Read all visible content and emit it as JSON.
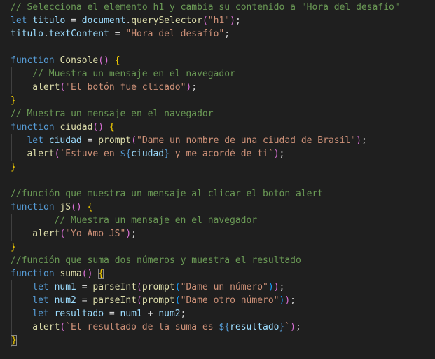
{
  "editor": {
    "language": "javascript",
    "lines": [
      {
        "indent": 0,
        "tokens": [
          {
            "t": "com",
            "v": "// Selecciona el elemento h1 y cambia su contenido a \"Hora del desafío\""
          }
        ]
      },
      {
        "indent": 0,
        "tokens": [
          {
            "t": "kw",
            "v": "let"
          },
          {
            "t": "op",
            "v": " "
          },
          {
            "t": "var",
            "v": "titulo"
          },
          {
            "t": "op",
            "v": " = "
          },
          {
            "t": "var",
            "v": "document"
          },
          {
            "t": "op",
            "v": "."
          },
          {
            "t": "fn",
            "v": "querySelector"
          },
          {
            "t": "br2",
            "v": "("
          },
          {
            "t": "str",
            "v": "\"h1\""
          },
          {
            "t": "br2",
            "v": ")"
          },
          {
            "t": "op",
            "v": ";"
          }
        ]
      },
      {
        "indent": 0,
        "tokens": [
          {
            "t": "var",
            "v": "titulo"
          },
          {
            "t": "op",
            "v": "."
          },
          {
            "t": "var",
            "v": "textContent"
          },
          {
            "t": "op",
            "v": " = "
          },
          {
            "t": "str",
            "v": "\"Hora del desafío\""
          },
          {
            "t": "op",
            "v": ";"
          }
        ]
      },
      {
        "indent": 0,
        "tokens": []
      },
      {
        "indent": 0,
        "tokens": [
          {
            "t": "kw",
            "v": "function"
          },
          {
            "t": "op",
            "v": " "
          },
          {
            "t": "fn",
            "v": "Console"
          },
          {
            "t": "br2",
            "v": "()"
          },
          {
            "t": "op",
            "v": " "
          },
          {
            "t": "br",
            "v": "{"
          }
        ]
      },
      {
        "indent": 4,
        "tokens": [
          {
            "t": "com",
            "v": "// Muestra un mensaje en el navegador"
          }
        ]
      },
      {
        "indent": 4,
        "tokens": [
          {
            "t": "fn",
            "v": "alert"
          },
          {
            "t": "br2",
            "v": "("
          },
          {
            "t": "str",
            "v": "\"El botón fue clicado\""
          },
          {
            "t": "br2",
            "v": ")"
          },
          {
            "t": "op",
            "v": ";"
          }
        ]
      },
      {
        "indent": 0,
        "tokens": [
          {
            "t": "br",
            "v": "}"
          }
        ]
      },
      {
        "indent": 0,
        "tokens": [
          {
            "t": "com",
            "v": "// Muestra un mensaje en el navegador"
          }
        ]
      },
      {
        "indent": 0,
        "tokens": [
          {
            "t": "kw",
            "v": "function"
          },
          {
            "t": "op",
            "v": " "
          },
          {
            "t": "fn",
            "v": "ciudad"
          },
          {
            "t": "br2",
            "v": "()"
          },
          {
            "t": "op",
            "v": " "
          },
          {
            "t": "br",
            "v": "{"
          }
        ]
      },
      {
        "indent": 3,
        "tokens": [
          {
            "t": "kw",
            "v": "let"
          },
          {
            "t": "op",
            "v": " "
          },
          {
            "t": "var",
            "v": "ciudad"
          },
          {
            "t": "op",
            "v": " = "
          },
          {
            "t": "fn",
            "v": "prompt"
          },
          {
            "t": "br2",
            "v": "("
          },
          {
            "t": "str",
            "v": "\"Dame un nombre de una ciudad de Brasil\""
          },
          {
            "t": "br2",
            "v": ")"
          },
          {
            "t": "op",
            "v": ";"
          }
        ]
      },
      {
        "indent": 3,
        "tokens": [
          {
            "t": "fn",
            "v": "alert"
          },
          {
            "t": "br2",
            "v": "("
          },
          {
            "t": "str",
            "v": "`Estuve en "
          },
          {
            "t": "kw",
            "v": "${"
          },
          {
            "t": "var",
            "v": "ciudad"
          },
          {
            "t": "kw",
            "v": "}"
          },
          {
            "t": "str",
            "v": " y me acordé de ti`"
          },
          {
            "t": "br2",
            "v": ")"
          },
          {
            "t": "op",
            "v": ";"
          }
        ]
      },
      {
        "indent": 0,
        "tokens": [
          {
            "t": "br",
            "v": "}"
          }
        ]
      },
      {
        "indent": 0,
        "tokens": []
      },
      {
        "indent": 0,
        "tokens": [
          {
            "t": "com",
            "v": "//función que muestra un mensaje al clicar el botón alert"
          }
        ]
      },
      {
        "indent": 0,
        "tokens": [
          {
            "t": "kw",
            "v": "function"
          },
          {
            "t": "op",
            "v": " "
          },
          {
            "t": "fn",
            "v": "jS"
          },
          {
            "t": "br2",
            "v": "()"
          },
          {
            "t": "op",
            "v": " "
          },
          {
            "t": "br",
            "v": "{"
          }
        ]
      },
      {
        "indent": 8,
        "tokens": [
          {
            "t": "com",
            "v": "// Muestra un mensaje en el navegador"
          }
        ]
      },
      {
        "indent": 4,
        "tokens": [
          {
            "t": "fn",
            "v": "alert"
          },
          {
            "t": "br2",
            "v": "("
          },
          {
            "t": "str",
            "v": "\"Yo Amo JS\""
          },
          {
            "t": "br2",
            "v": ")"
          },
          {
            "t": "op",
            "v": ";"
          }
        ]
      },
      {
        "indent": 0,
        "tokens": [
          {
            "t": "br",
            "v": "}"
          }
        ]
      },
      {
        "indent": 0,
        "tokens": [
          {
            "t": "com",
            "v": "//función que suma dos números y muestra el resultado"
          }
        ]
      },
      {
        "indent": 0,
        "tokens": [
          {
            "t": "kw",
            "v": "function"
          },
          {
            "t": "op",
            "v": " "
          },
          {
            "t": "fn",
            "v": "suma"
          },
          {
            "t": "br2",
            "v": "()"
          },
          {
            "t": "op",
            "v": " "
          },
          {
            "t": "br",
            "v": "{",
            "c": "match"
          }
        ]
      },
      {
        "indent": 4,
        "tokens": [
          {
            "t": "kw",
            "v": "let"
          },
          {
            "t": "op",
            "v": " "
          },
          {
            "t": "var",
            "v": "num1"
          },
          {
            "t": "op",
            "v": " = "
          },
          {
            "t": "fn",
            "v": "parseInt"
          },
          {
            "t": "br2",
            "v": "("
          },
          {
            "t": "fn",
            "v": "prompt"
          },
          {
            "t": "br3",
            "v": "("
          },
          {
            "t": "str",
            "v": "\"Dame un número\""
          },
          {
            "t": "br3",
            "v": ")"
          },
          {
            "t": "br2",
            "v": ")"
          },
          {
            "t": "op",
            "v": ";"
          }
        ]
      },
      {
        "indent": 4,
        "tokens": [
          {
            "t": "kw",
            "v": "let"
          },
          {
            "t": "op",
            "v": " "
          },
          {
            "t": "var",
            "v": "num2"
          },
          {
            "t": "op",
            "v": " = "
          },
          {
            "t": "fn",
            "v": "parseInt"
          },
          {
            "t": "br2",
            "v": "("
          },
          {
            "t": "fn",
            "v": "prompt"
          },
          {
            "t": "br3",
            "v": "("
          },
          {
            "t": "str",
            "v": "\"Dame otro número\""
          },
          {
            "t": "br3",
            "v": ")"
          },
          {
            "t": "br2",
            "v": ")"
          },
          {
            "t": "op",
            "v": ";"
          }
        ]
      },
      {
        "indent": 4,
        "tokens": [
          {
            "t": "kw",
            "v": "let"
          },
          {
            "t": "op",
            "v": " "
          },
          {
            "t": "var",
            "v": "resultado"
          },
          {
            "t": "op",
            "v": " = "
          },
          {
            "t": "var",
            "v": "num1"
          },
          {
            "t": "op",
            "v": " + "
          },
          {
            "t": "var",
            "v": "num2"
          },
          {
            "t": "op",
            "v": ";"
          }
        ]
      },
      {
        "indent": 4,
        "tokens": [
          {
            "t": "fn",
            "v": "alert"
          },
          {
            "t": "br2",
            "v": "("
          },
          {
            "t": "str",
            "v": "`El resultado de la suma es "
          },
          {
            "t": "kw",
            "v": "${"
          },
          {
            "t": "var",
            "v": "resultado"
          },
          {
            "t": "kw",
            "v": "}"
          },
          {
            "t": "str",
            "v": "`"
          },
          {
            "t": "br2",
            "v": ")"
          },
          {
            "t": "op",
            "v": ";"
          }
        ]
      },
      {
        "indent": 0,
        "tokens": [
          {
            "t": "br",
            "v": "}",
            "c": "match caret"
          }
        ]
      }
    ]
  }
}
